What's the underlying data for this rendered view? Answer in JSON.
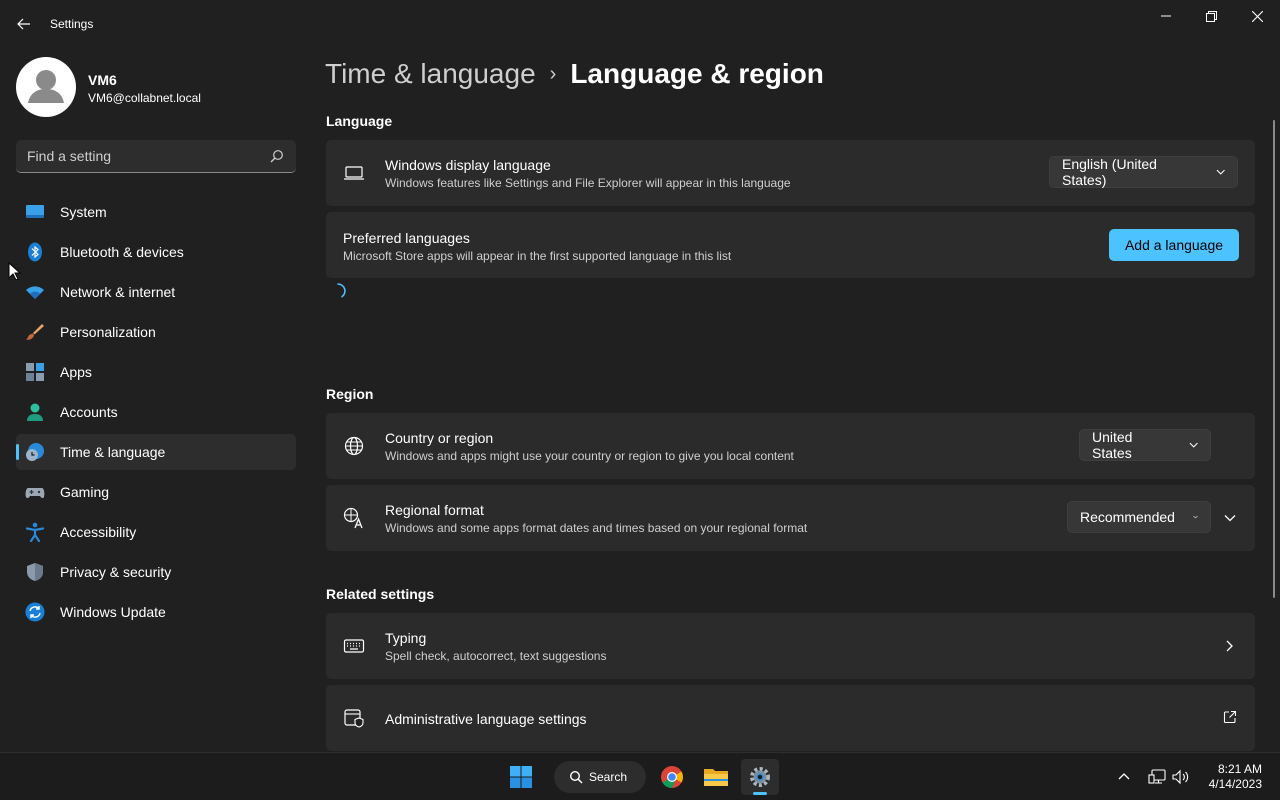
{
  "window": {
    "title": "Settings"
  },
  "user": {
    "name": "VM6",
    "email": "VM6@collabnet.local"
  },
  "search": {
    "placeholder": "Find a setting"
  },
  "nav": {
    "items": [
      {
        "label": "System",
        "icon": "system-icon",
        "active": false
      },
      {
        "label": "Bluetooth & devices",
        "icon": "bluetooth-icon",
        "active": false
      },
      {
        "label": "Network & internet",
        "icon": "wifi-icon",
        "active": false
      },
      {
        "label": "Personalization",
        "icon": "brush-icon",
        "active": false
      },
      {
        "label": "Apps",
        "icon": "apps-icon",
        "active": false
      },
      {
        "label": "Accounts",
        "icon": "person-icon",
        "active": false
      },
      {
        "label": "Time & language",
        "icon": "globe-clock-icon",
        "active": true
      },
      {
        "label": "Gaming",
        "icon": "gamepad-icon",
        "active": false
      },
      {
        "label": "Accessibility",
        "icon": "accessibility-icon",
        "active": false
      },
      {
        "label": "Privacy & security",
        "icon": "shield-icon",
        "active": false
      },
      {
        "label": "Windows Update",
        "icon": "update-icon",
        "active": false
      }
    ]
  },
  "breadcrumb": {
    "parent": "Time & language",
    "separator": "›",
    "current": "Language & region"
  },
  "language": {
    "section_title": "Language",
    "display_language": {
      "title": "Windows display language",
      "description": "Windows features like Settings and File Explorer will appear in this language",
      "value": "English (United States)"
    },
    "preferred": {
      "title": "Preferred languages",
      "description": "Microsoft Store apps will appear in the first supported language in this list",
      "button": "Add a language"
    }
  },
  "region": {
    "section_title": "Region",
    "country": {
      "title": "Country or region",
      "description": "Windows and apps might use your country or region to give you local content",
      "value": "United States"
    },
    "format": {
      "title": "Regional format",
      "description": "Windows and some apps format dates and times based on your regional format",
      "value": "Recommended"
    }
  },
  "related": {
    "section_title": "Related settings",
    "typing": {
      "title": "Typing",
      "description": "Spell check, autocorrect, text suggestions"
    },
    "admin": {
      "title": "Administrative language settings"
    }
  },
  "taskbar": {
    "search_label": "Search",
    "time": "8:21 AM",
    "date": "4/14/2023"
  },
  "colors": {
    "accent": "#4cc2ff",
    "background": "#202020",
    "card": "#2b2b2b",
    "taskbar": "#1c1c1c"
  }
}
